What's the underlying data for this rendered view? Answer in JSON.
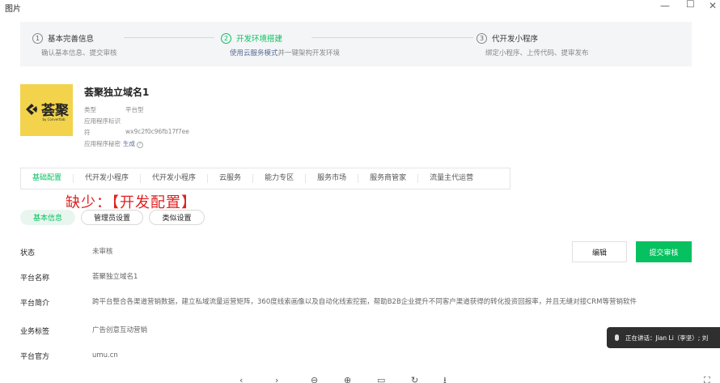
{
  "window": {
    "title": "图片",
    "minimize": "—",
    "maximize": "☐",
    "close": "✕"
  },
  "steps": [
    {
      "num": "1",
      "title": "基本完善信息",
      "desc": "确认基本信息、提交审核"
    },
    {
      "num": "2",
      "title": "开发环境搭建",
      "desc_link": "使用云服务模式",
      "desc_rest": "并一键架构开发环境"
    },
    {
      "num": "3",
      "title": "代开发小程序",
      "desc": "绑定小程序、上传代码、提审发布"
    }
  ],
  "app": {
    "logo_text": "荟聚",
    "logo_sub": "by Convertlab",
    "name": "荟聚独立域名1",
    "meta": [
      {
        "label": "类型",
        "value": "平台型"
      },
      {
        "label": "应用程序标识",
        "value": ""
      },
      {
        "label": "符",
        "value": "wx9c2f0c96fb17f7ee"
      },
      {
        "label": "应用程序秘密",
        "value": "",
        "link": "生成"
      }
    ]
  },
  "tabs": [
    "基础配置",
    "代开发小程序",
    "代开发小程序",
    "云服务",
    "能力专区",
    "服务市场",
    "服务商管家",
    "流量主代运营"
  ],
  "annotation": "缺少：【开发配置】",
  "subtabs": {
    "selected": "基本信息",
    "admin": "管理员设置",
    "similar": "类似设置"
  },
  "buttons": {
    "edit": "编辑",
    "submit": "提交审核"
  },
  "rows": [
    {
      "label": "状态",
      "value": "未审核"
    },
    {
      "label": "平台名称",
      "value": "荟聚独立域名1"
    },
    {
      "label": "平台简介",
      "value": "跨平台整合各渠道营销数据，建立私域流量运营矩阵，360度线索画像以及自动化线索挖掘，帮助B2B企业提升不同客户渠道获得的转化投资回报率，并且无缝对接CRM等营销软件"
    },
    {
      "label": "业务标签",
      "value": "广告创意互动营销"
    },
    {
      "label": "平台官方",
      "value": "umu.cn"
    }
  ],
  "speaking": {
    "text": "正在讲话：Jian Li（李坚）; 刘"
  },
  "bottom_icons": [
    "‹",
    "›",
    "⊖",
    "⊕",
    "▭",
    "↻",
    "⭳",
    "⛶"
  ]
}
